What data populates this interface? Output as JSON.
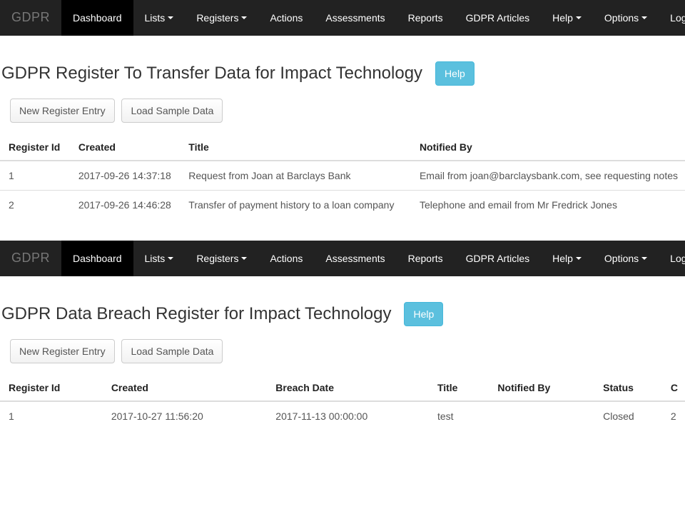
{
  "brand": "GDPR",
  "nav": {
    "items": [
      {
        "label": "Dashboard",
        "active": true,
        "dropdown": false
      },
      {
        "label": "Lists",
        "active": false,
        "dropdown": true
      },
      {
        "label": "Registers",
        "active": false,
        "dropdown": true
      },
      {
        "label": "Actions",
        "active": false,
        "dropdown": false
      },
      {
        "label": "Assessments",
        "active": false,
        "dropdown": false
      },
      {
        "label": "Reports",
        "active": false,
        "dropdown": false
      },
      {
        "label": "GDPR Articles",
        "active": false,
        "dropdown": false
      },
      {
        "label": "Help",
        "active": false,
        "dropdown": true
      },
      {
        "label": "Options",
        "active": false,
        "dropdown": true
      },
      {
        "label": "Log Out",
        "active": false,
        "dropdown": false
      }
    ]
  },
  "help_label": "Help",
  "buttons": {
    "new_entry": "New Register Entry",
    "load_sample": "Load Sample Data"
  },
  "panel1": {
    "title": "GDPR Register To Transfer Data for Impact Technology",
    "columns": [
      "Register Id",
      "Created",
      "Title",
      "Notified By"
    ],
    "rows": [
      {
        "id": "1",
        "created": "2017-09-26 14:37:18",
        "title": "Request from Joan at Barclays Bank",
        "notified_by": "Email from joan@barclaysbank.com, see requesting notes"
      },
      {
        "id": "2",
        "created": "2017-09-26 14:46:28",
        "title": "Transfer of payment history to a loan company",
        "notified_by": "Telephone and email from Mr Fredrick Jones"
      }
    ]
  },
  "panel2": {
    "title": "GDPR Data Breach Register for Impact Technology",
    "columns": [
      "Register Id",
      "Created",
      "Breach Date",
      "Title",
      "Notified By",
      "Status",
      "C"
    ],
    "rows": [
      {
        "id": "1",
        "created": "2017-10-27 11:56:20",
        "breach_date": "2017-11-13 00:00:00",
        "title": "test",
        "notified_by": "",
        "status": "Closed",
        "c": "2"
      }
    ]
  }
}
